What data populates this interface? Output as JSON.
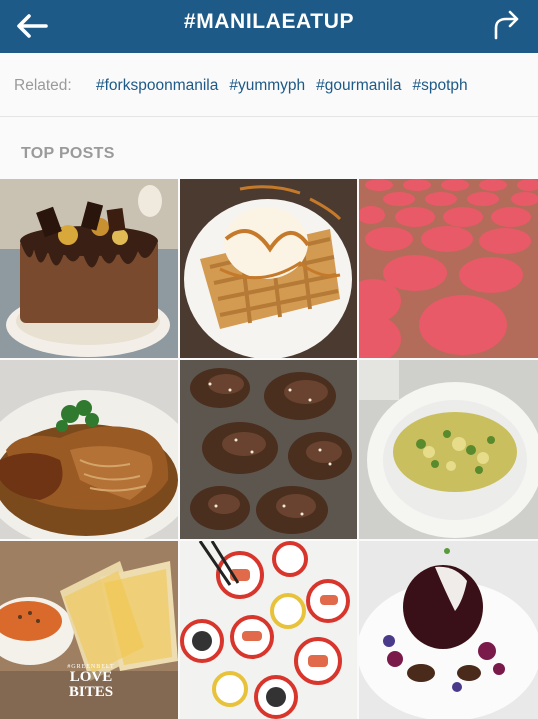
{
  "header": {
    "title": "#MANILAEATUP",
    "back_icon": "arrow-left-icon",
    "share_icon": "share-arrow-icon",
    "bar_color": "#1e5a87"
  },
  "related": {
    "label": "Related:",
    "tags": [
      "#forkspoonmanila",
      "#yummyph",
      "#gourmanila",
      "#spotph"
    ],
    "tag_color": "#1e5a87"
  },
  "top_posts": {
    "title": "TOP POSTS",
    "posts": [
      {
        "subject": "chocolate drip cake with gold chocolates"
      },
      {
        "subject": "waffle with ice cream and caramel"
      },
      {
        "subject": "pink macarons on baking mat"
      },
      {
        "subject": "braised pork with gravy and herbs"
      },
      {
        "subject": "roasted chicken wings with sesame"
      },
      {
        "subject": "vegetable omelette on white plate"
      },
      {
        "subject": "grilled cheese sandwich with tomato soup",
        "overlay_line1": "#GREENBELT",
        "overlay_line2": "LOVE",
        "overlay_line3": "BITES"
      },
      {
        "subject": "sushi plates on table"
      },
      {
        "subject": "chocolate dome dessert with berries"
      }
    ]
  }
}
